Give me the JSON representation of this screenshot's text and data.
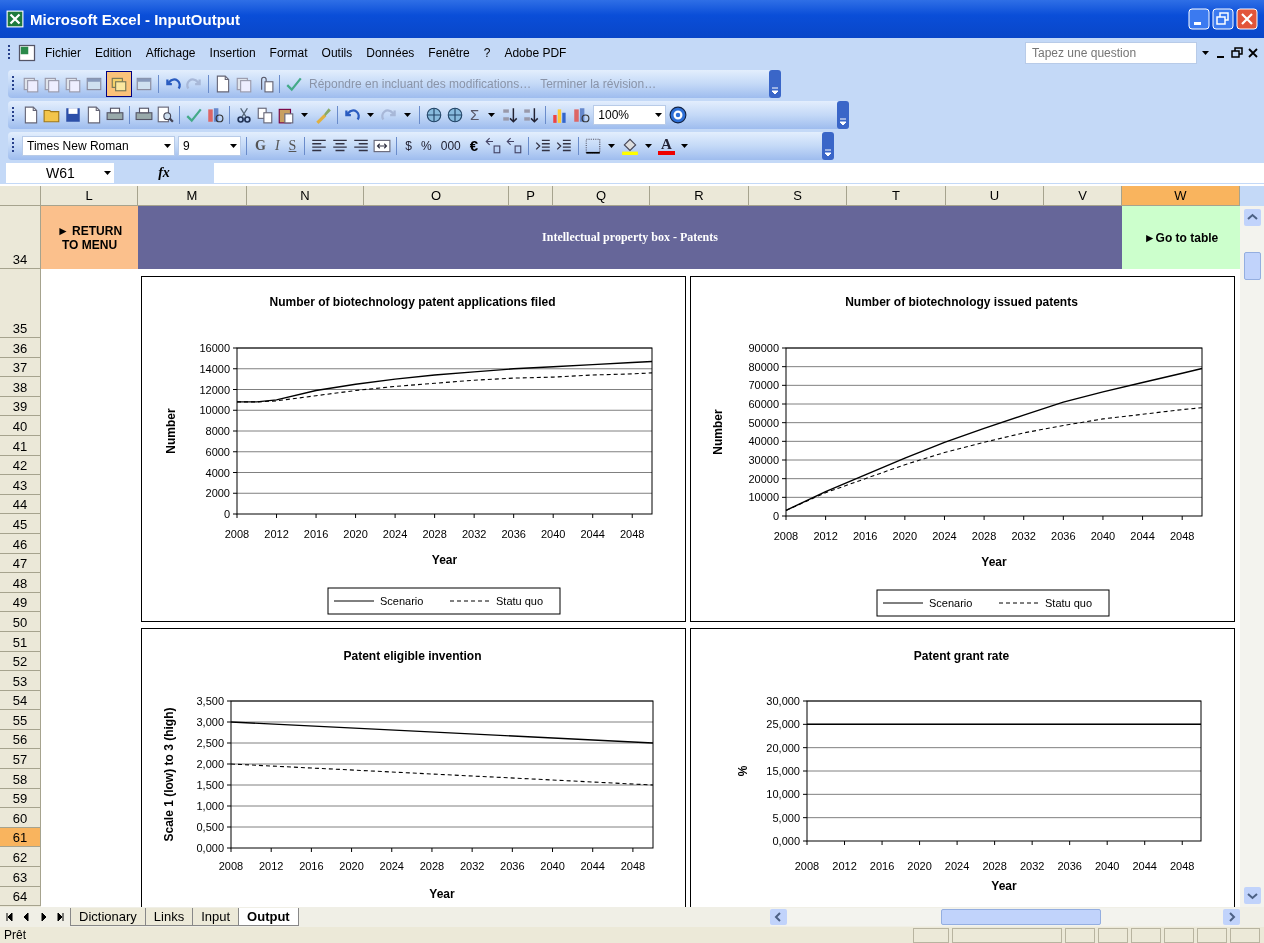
{
  "window": {
    "title": "Microsoft Excel - InputOutput"
  },
  "menu": [
    {
      "label": "Fichier"
    },
    {
      "label": "Edition"
    },
    {
      "label": "Affichage"
    },
    {
      "label": "Insertion"
    },
    {
      "label": "Format"
    },
    {
      "label": "Outils"
    },
    {
      "label": "Données"
    },
    {
      "label": "Fenêtre"
    },
    {
      "label": "?"
    },
    {
      "label": "Adobe PDF"
    }
  ],
  "help_box": {
    "placeholder": "Tapez une question"
  },
  "reviewing_toolbar": {
    "pressed_button_on": true,
    "reply_label": "Répondre en incluant des modifications…",
    "end_review_label": "Terminer la révision…"
  },
  "standard_toolbar": {
    "sum": "Σ",
    "zoom": "100%"
  },
  "formatting_toolbar": {
    "font": "Times New Roman",
    "size": "9",
    "bold": "G",
    "italic": "I",
    "underline": "S",
    "currency": "$",
    "percent": "%",
    "thousands": "000",
    "euro": "€",
    "font_color": "A"
  },
  "formula_bar": {
    "name_box": "W61",
    "fx": "fx"
  },
  "columns": [
    {
      "label": "L",
      "selected": false
    },
    {
      "label": "M",
      "selected": false
    },
    {
      "label": "N",
      "selected": false
    },
    {
      "label": "O",
      "selected": false
    },
    {
      "label": "P",
      "selected": false
    },
    {
      "label": "Q",
      "selected": false
    },
    {
      "label": "R",
      "selected": false
    },
    {
      "label": "S",
      "selected": false
    },
    {
      "label": "T",
      "selected": false
    },
    {
      "label": "U",
      "selected": false
    },
    {
      "label": "V",
      "selected": false
    },
    {
      "label": "W",
      "selected": true
    }
  ],
  "rows": [
    {
      "label": "34",
      "selected": false
    },
    {
      "label": "35",
      "selected": false
    },
    {
      "label": "36",
      "selected": false
    },
    {
      "label": "37",
      "selected": false
    },
    {
      "label": "38",
      "selected": false
    },
    {
      "label": "39",
      "selected": false
    },
    {
      "label": "40",
      "selected": false
    },
    {
      "label": "41",
      "selected": false
    },
    {
      "label": "42",
      "selected": false
    },
    {
      "label": "43",
      "selected": false
    },
    {
      "label": "44",
      "selected": false
    },
    {
      "label": "45",
      "selected": false
    },
    {
      "label": "46",
      "selected": false
    },
    {
      "label": "47",
      "selected": false
    },
    {
      "label": "48",
      "selected": false
    },
    {
      "label": "49",
      "selected": false
    },
    {
      "label": "50",
      "selected": false
    },
    {
      "label": "51",
      "selected": false
    },
    {
      "label": "52",
      "selected": false
    },
    {
      "label": "53",
      "selected": false
    },
    {
      "label": "54",
      "selected": false
    },
    {
      "label": "55",
      "selected": false
    },
    {
      "label": "56",
      "selected": false
    },
    {
      "label": "57",
      "selected": false
    },
    {
      "label": "58",
      "selected": false
    },
    {
      "label": "59",
      "selected": false
    },
    {
      "label": "60",
      "selected": false
    },
    {
      "label": "61",
      "selected": true
    },
    {
      "label": "62",
      "selected": false
    },
    {
      "label": "63",
      "selected": false
    },
    {
      "label": "64",
      "selected": false
    }
  ],
  "banner": {
    "return_lines": [
      "► RETURN",
      "TO MENU"
    ],
    "title": "Intellectual property box - Patents",
    "goto_label": "►Go to table"
  },
  "charts": [
    {
      "chart_data": {
        "type": "line",
        "title": "Number of biotechnology patent applications filed",
        "xlabel": "Year",
        "ylabel": "Number",
        "x": [
          2008,
          2010,
          2012,
          2016,
          2020,
          2024,
          2028,
          2032,
          2036,
          2040,
          2044,
          2048,
          2050
        ],
        "xlim": [
          2008,
          2050
        ],
        "ylim": [
          0,
          16000
        ],
        "xticks": [
          2008,
          2012,
          2016,
          2020,
          2024,
          2028,
          2032,
          2036,
          2040,
          2044,
          2048
        ],
        "yticks": [
          0,
          2000,
          4000,
          6000,
          8000,
          10000,
          12000,
          14000,
          16000
        ],
        "grid": true,
        "legend": true,
        "series": [
          {
            "name": "Scenario",
            "color": "#000000",
            "line_style": "solid",
            "values": [
              10800,
              10800,
              11000,
              11900,
              12500,
              13000,
              13400,
              13700,
              14000,
              14200,
              14400,
              14600,
              14700
            ]
          },
          {
            "name": "Statu quo",
            "color": "#000000",
            "line_style": "dashed",
            "values": [
              10800,
              10800,
              10900,
              11400,
              11900,
              12300,
              12600,
              12900,
              13100,
              13200,
              13400,
              13500,
              13600
            ]
          }
        ]
      }
    },
    {
      "chart_data": {
        "type": "line",
        "title": "Number of biotechnology issued patents",
        "xlabel": "Year",
        "ylabel": "Number",
        "x": [
          2008,
          2012,
          2016,
          2020,
          2024,
          2028,
          2032,
          2036,
          2040,
          2044,
          2048,
          2050
        ],
        "xlim": [
          2008,
          2050
        ],
        "ylim": [
          0,
          90000
        ],
        "xticks": [
          2008,
          2012,
          2016,
          2020,
          2024,
          2028,
          2032,
          2036,
          2040,
          2044,
          2048
        ],
        "yticks": [
          0,
          10000,
          20000,
          30000,
          40000,
          50000,
          60000,
          70000,
          80000,
          90000
        ],
        "grid": true,
        "legend": true,
        "series": [
          {
            "name": "Scenario",
            "color": "#000000",
            "line_style": "solid",
            "values": [
              3000,
              13000,
              22000,
              31000,
              39500,
              47000,
              54000,
              61000,
              66500,
              71500,
              76500,
              79000
            ]
          },
          {
            "name": "Statu quo",
            "color": "#000000",
            "line_style": "dashed",
            "values": [
              3000,
              12500,
              20000,
              27500,
              34000,
              39500,
              44500,
              48500,
              52000,
              54500,
              57000,
              58000
            ]
          }
        ]
      }
    },
    {
      "chart_data": {
        "type": "line",
        "title": "Patent eligible invention",
        "xlabel": "Year",
        "ylabel": "Scale 1 (low) to 3 (high)",
        "x": [
          2008,
          2050
        ],
        "xlim": [
          2008,
          2050
        ],
        "ylim": [
          0,
          3.5
        ],
        "xticks": [
          2008,
          2012,
          2016,
          2020,
          2024,
          2028,
          2032,
          2036,
          2040,
          2044,
          2048
        ],
        "yticks": [
          {
            "value": 0,
            "label": "0,000"
          },
          {
            "value": 0.5,
            "label": "0,500"
          },
          {
            "value": 1,
            "label": "1,000"
          },
          {
            "value": 1.5,
            "label": "1,500"
          },
          {
            "value": 2,
            "label": "2,000"
          },
          {
            "value": 2.5,
            "label": "2,500"
          },
          {
            "value": 3,
            "label": "3,000"
          },
          {
            "value": 3.5,
            "label": "3,500"
          }
        ],
        "grid": true,
        "series": [
          {
            "color": "#000000",
            "line_style": "solid",
            "values": [
              3,
              2.5
            ]
          },
          {
            "color": "#000000",
            "line_style": "dashed",
            "values": [
              2,
              1.5
            ]
          }
        ]
      }
    },
    {
      "chart_data": {
        "type": "line",
        "title": "Patent grant rate",
        "xlabel": "Year",
        "ylabel": "%",
        "x": [
          2008,
          2050
        ],
        "xlim": [
          2008,
          2050
        ],
        "ylim": [
          0,
          30
        ],
        "xticks": [
          2008,
          2012,
          2016,
          2020,
          2024,
          2028,
          2032,
          2036,
          2040,
          2044,
          2048
        ],
        "yticks": [
          {
            "value": 0,
            "label": "0,000"
          },
          {
            "value": 5,
            "label": "5,000"
          },
          {
            "value": 10,
            "label": "10,000"
          },
          {
            "value": 15,
            "label": "15,000"
          },
          {
            "value": 20,
            "label": "20,000"
          },
          {
            "value": 25,
            "label": "25,000"
          },
          {
            "value": 30,
            "label": "30,000"
          }
        ],
        "grid": true,
        "series": [
          {
            "color": "#000000",
            "line_style": "solid",
            "values": [
              25,
              25
            ]
          }
        ]
      }
    }
  ],
  "sheet_tabs": [
    {
      "label": "Dictionary",
      "selected": false
    },
    {
      "label": "Links",
      "selected": false
    },
    {
      "label": "Input",
      "selected": false
    },
    {
      "label": "Output",
      "selected": true
    }
  ],
  "status_bar": {
    "text": "Prêt"
  }
}
